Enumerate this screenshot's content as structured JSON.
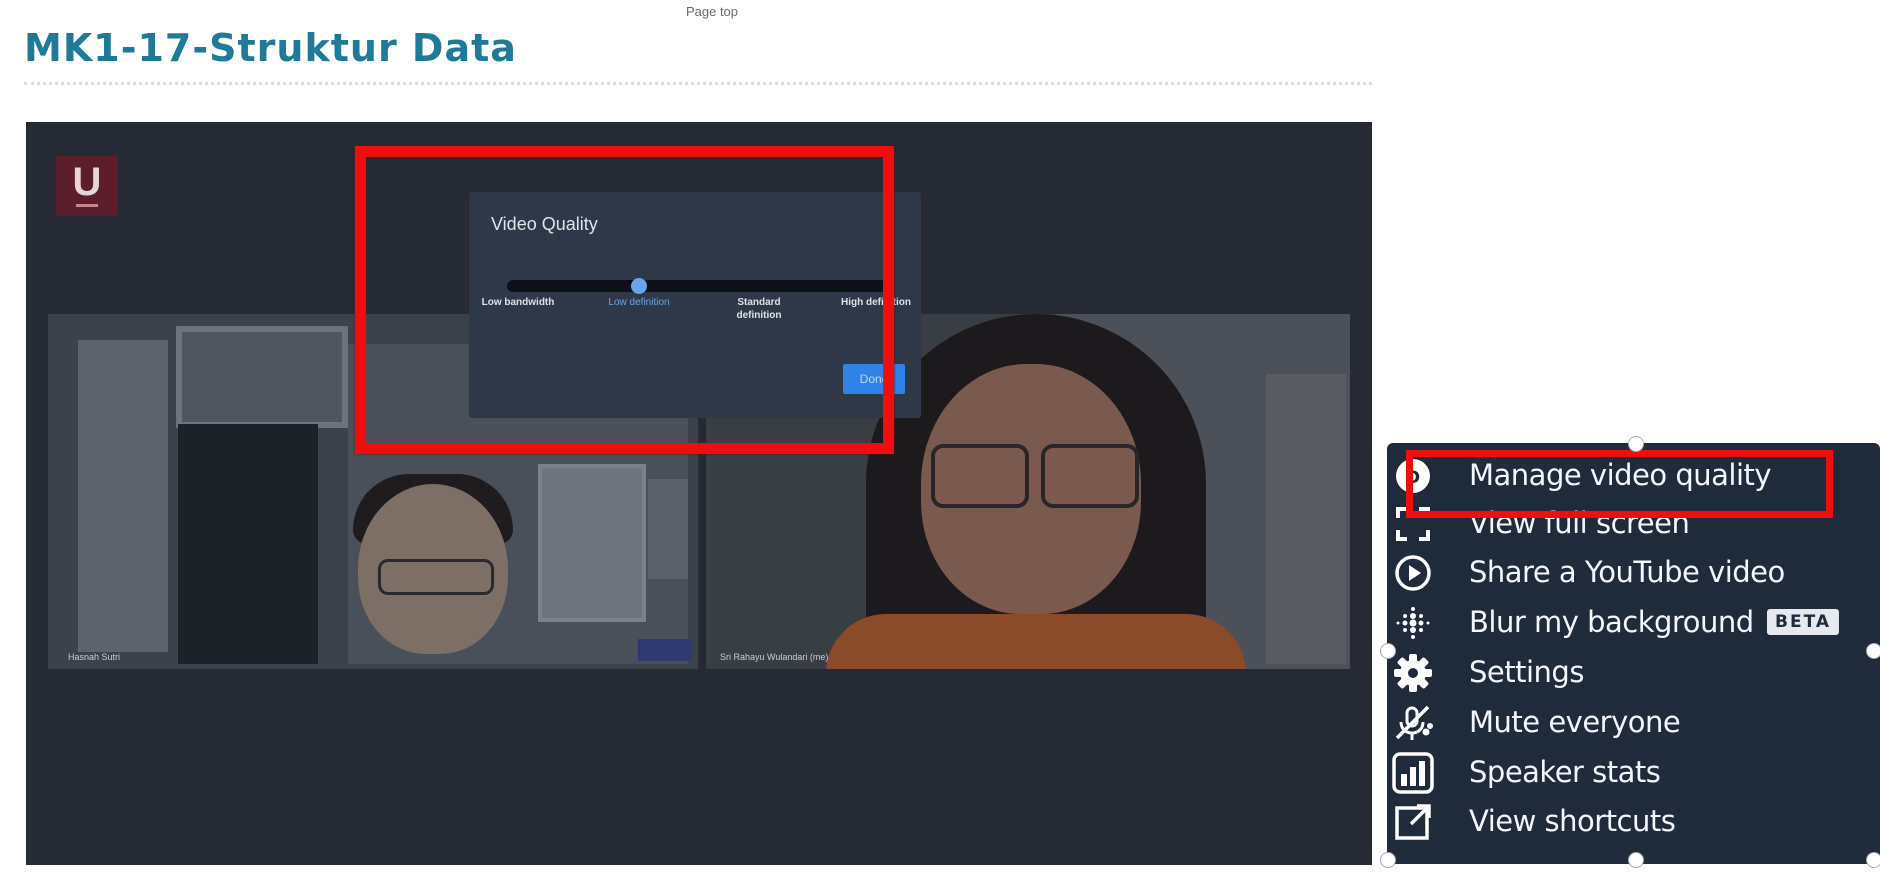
{
  "page": {
    "top_link": "Page top",
    "title": "MK1-17-Struktur Data"
  },
  "stage": {
    "logo_letter": "U",
    "participants": [
      {
        "name": "Hasnah Sutri"
      },
      {
        "name": "Sri Rahayu Wulandari (me)"
      }
    ]
  },
  "video_quality": {
    "title": "Video Quality",
    "slider_selected": 1,
    "levels": [
      "Low bandwidth",
      "Low definition",
      "Standard definition",
      "High definition"
    ],
    "done_label": "Done"
  },
  "menu": {
    "items": [
      {
        "label": "Manage video quality",
        "icon": "hd-quality-icon"
      },
      {
        "label": "View full screen",
        "icon": "fullscreen-icon"
      },
      {
        "label": "Share a YouTube video",
        "icon": "play-circle-icon"
      },
      {
        "label": "Blur my background",
        "icon": "blur-icon",
        "badge": "BETA"
      },
      {
        "label": "Settings",
        "icon": "gear-icon"
      },
      {
        "label": "Mute everyone",
        "icon": "mute-mic-icon"
      },
      {
        "label": "Speaker stats",
        "icon": "bar-chart-icon"
      },
      {
        "label": "View shortcuts",
        "icon": "external-link-icon"
      }
    ]
  },
  "colors": {
    "title": "#1f7a99",
    "highlight": "#ee0e0e",
    "stage_bg": "#252a35",
    "menu_bg": "#1f2a3b",
    "accent": "#2f83e6"
  }
}
